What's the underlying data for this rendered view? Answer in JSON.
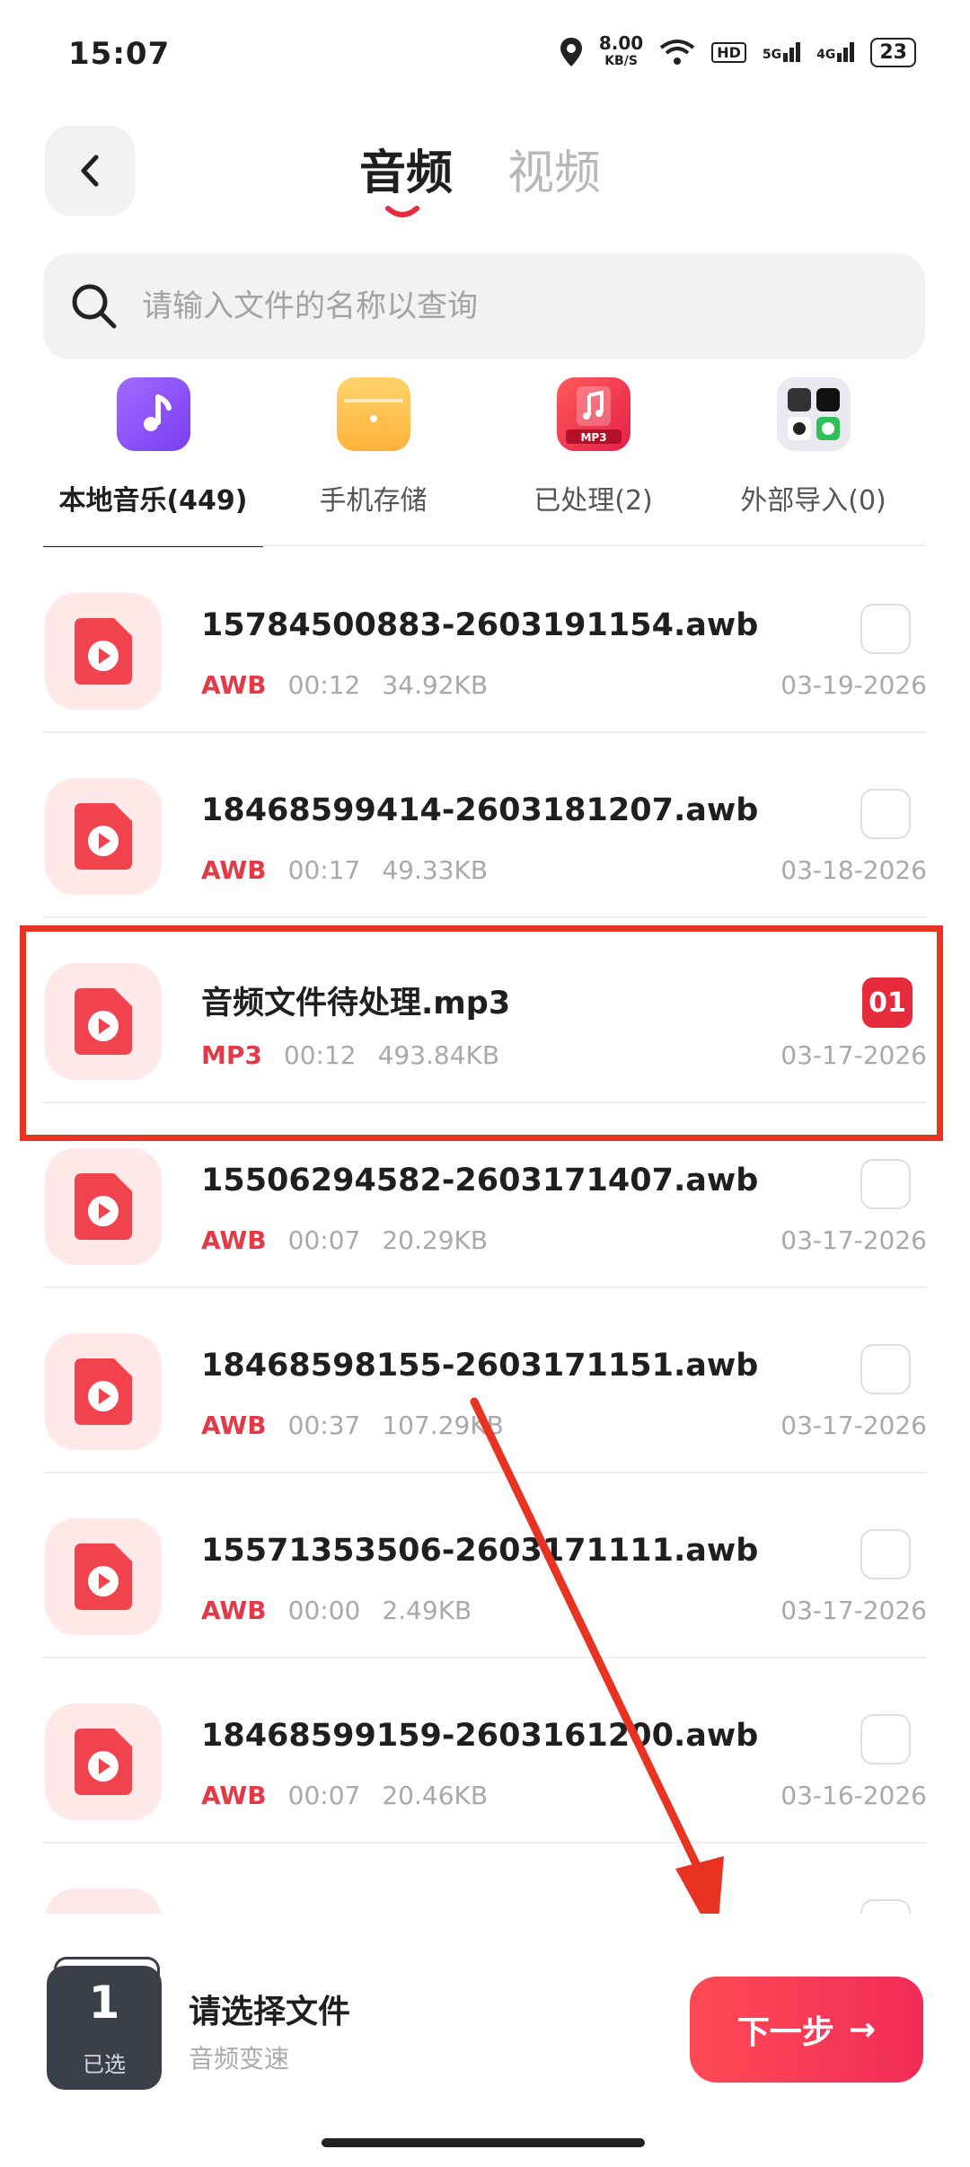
{
  "status_bar": {
    "time": "15:07",
    "speed_value": "8.00",
    "speed_unit": "KB/S",
    "hd_label": "HD",
    "signal1_label": "5G",
    "signal2_label": "4G",
    "battery": "23"
  },
  "header": {
    "tab_audio": "音频",
    "tab_video": "视频",
    "active_tab": "音频",
    "accent_color": "#e52b3c"
  },
  "search": {
    "placeholder": "请输入文件的名称以查询",
    "value": ""
  },
  "categories": [
    {
      "label": "本地音乐(449)",
      "icon": "music-note-icon",
      "active": true
    },
    {
      "label": "手机存储",
      "icon": "folder-icon",
      "active": false
    },
    {
      "label": "已处理(2)",
      "icon": "mp3-icon",
      "active": false
    },
    {
      "label": "外部导入(0)",
      "icon": "app-grid-icon",
      "active": false
    }
  ],
  "files": [
    {
      "name": "15784500883-2603191154.awb",
      "format": "AWB",
      "duration": "00:12",
      "size": "34.92KB",
      "date": "03-19-2026",
      "selected": false
    },
    {
      "name": "18468599414-2603181207.awb",
      "format": "AWB",
      "duration": "00:17",
      "size": "49.33KB",
      "date": "03-18-2026",
      "selected": false
    },
    {
      "name": "音频文件待处理.mp3",
      "format": "MP3",
      "duration": "00:12",
      "size": "493.84KB",
      "date": "03-17-2026",
      "selected": true,
      "badge": "01"
    },
    {
      "name": "15506294582-2603171407.awb",
      "format": "AWB",
      "duration": "00:07",
      "size": "20.29KB",
      "date": "03-17-2026",
      "selected": false
    },
    {
      "name": "18468598155-2603171151.awb",
      "format": "AWB",
      "duration": "00:37",
      "size": "107.29KB",
      "date": "03-17-2026",
      "selected": false
    },
    {
      "name": "15571353506-2603171111.awb",
      "format": "AWB",
      "duration": "00:00",
      "size": "2.49KB",
      "date": "03-17-2026",
      "selected": false
    },
    {
      "name": "18468599159-2603161200.awb",
      "format": "AWB",
      "duration": "00:07",
      "size": "20.46KB",
      "date": "03-16-2026",
      "selected": false
    }
  ],
  "bottom_bar": {
    "selected_count": "1",
    "selected_label": "已选",
    "title": "请选择文件",
    "subtitle": "音频变速",
    "next_label": "下一步",
    "next_arrow": "→"
  }
}
